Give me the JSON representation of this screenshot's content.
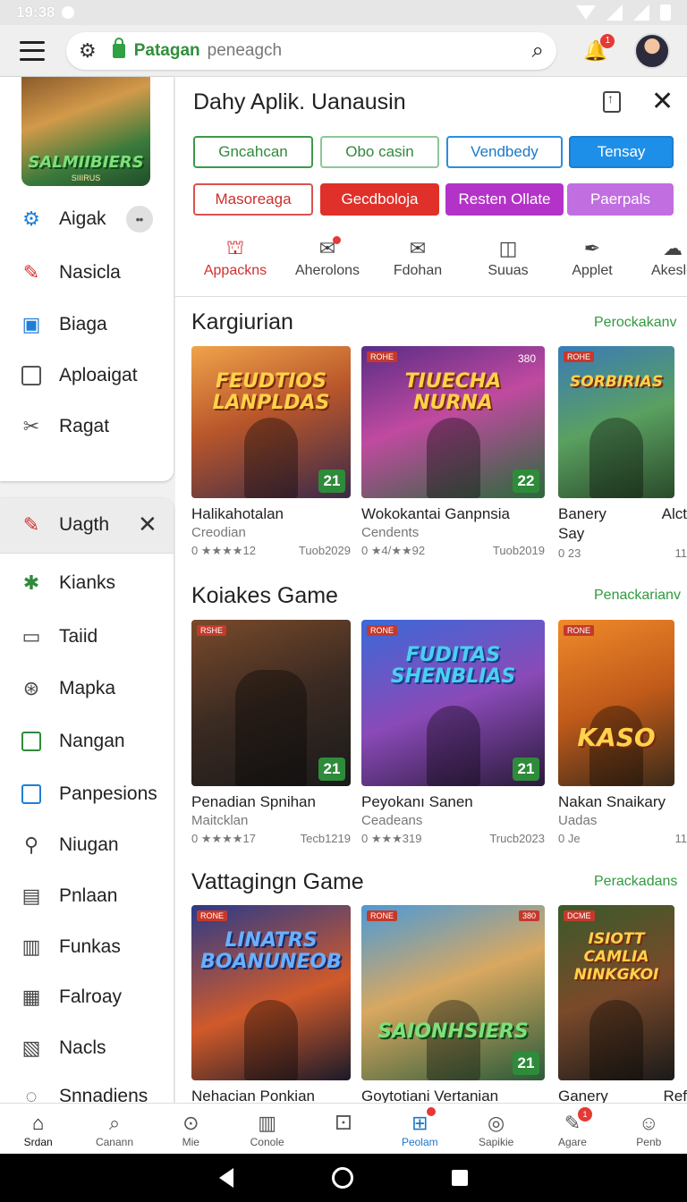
{
  "status": {
    "time": "19:38"
  },
  "appbar": {
    "brand": "Patagan",
    "query": "peneagch",
    "notif_count": "1"
  },
  "sidebar_top": {
    "items": [
      {
        "label": "Aigak",
        "icon": "gear-icon",
        "color": "#1e7fd8"
      },
      {
        "label": "Nasicla",
        "icon": "edit-box-icon",
        "color": "#d32f2f"
      },
      {
        "label": "Biaga",
        "icon": "bag-icon",
        "color": "#1e7fd8"
      },
      {
        "label": "Aploaigat",
        "icon": "square-icon",
        "color": "#555555"
      },
      {
        "label": "Ragat",
        "icon": "tools-icon",
        "color": "#555555"
      }
    ],
    "hero_logo": "SALMIIBIERS",
    "hero_sub": "SIIIRUS"
  },
  "sidebar_bottom": {
    "header": "Uagth",
    "items": [
      {
        "label": "Kianks",
        "icon": "puzzle-icon",
        "color": "#2e8b3a"
      },
      {
        "label": "Taiid",
        "icon": "clipboard-icon",
        "color": "#444444"
      },
      {
        "label": "Mapka",
        "icon": "map-pin-icon",
        "color": "#444444"
      },
      {
        "label": "Nangan",
        "icon": "green-square-icon",
        "color": "#2e8b3a"
      },
      {
        "label": "Panpesions",
        "icon": "blue-square-icon",
        "color": "#1e7fd8"
      },
      {
        "label": "Niugan",
        "icon": "link-icon",
        "color": "#444444"
      },
      {
        "label": "Pnlaan",
        "icon": "calendar-icon",
        "color": "#444444"
      },
      {
        "label": "Funkas",
        "icon": "list-box-icon",
        "color": "#444444"
      },
      {
        "label": "Falroay",
        "icon": "document-icon",
        "color": "#444444"
      },
      {
        "label": "Nacls",
        "icon": "folder-icon",
        "color": "#444444"
      },
      {
        "label": "Snnadiens",
        "icon": "chat-icon",
        "color": "#444444"
      }
    ]
  },
  "dialog": {
    "title": "Dahy Aplik. Uanausin",
    "chips_row1": [
      "Gncahcan",
      "Obo casin",
      "Vendbedy",
      "Tensay"
    ],
    "chips_row2": [
      "Masoreaga",
      "Gecdboloja",
      "Resten Ollate",
      "Paerpals"
    ],
    "tabs": [
      "Appackns",
      "Aherolons",
      "Fdohan",
      "Suuas",
      "Applet",
      "Akesle"
    ]
  },
  "sections": [
    {
      "title": "Kargiurian",
      "link": "Perockakanv",
      "cards": [
        {
          "logo": "FEUDTIOS LANPLDAS",
          "tag": "",
          "rank": "21",
          "title": "Halikahotalan",
          "sub": "Creodian",
          "rating": "0 ★★★★12",
          "date": "Tuob2029",
          "bg": "linear-gradient(160deg,#f0a34a 0%,#b8562b 45%,#3a2a4a 100%)"
        },
        {
          "logo": "TIUECHA NURNA",
          "tag": "ROHE",
          "badge": "380",
          "rank": "22",
          "title": "Wokokantai Ganpnsia",
          "sub": "Cendents",
          "rating": "0 ★4/★★92",
          "date": "Tuob2019",
          "bg": "linear-gradient(160deg,#5a2c86 0%,#c04aa0 45%,#2a6a3a 100%)"
        },
        {
          "logo": "SORBIRIAS",
          "tag": "ROHE",
          "rank": "",
          "title": "Banery",
          "title2": "Alct",
          "sub": "Say",
          "rating": "0 23",
          "date": "11",
          "bg": "linear-gradient(160deg,#3a7ab8 0%,#5aa060 50%,#2a4a2a 100%)"
        }
      ]
    },
    {
      "title": "Koiakes Game",
      "link": "Penackarianv",
      "cards": [
        {
          "logo": "",
          "tag": "RSHE",
          "rank": "21",
          "title": "Penadian Spnihan",
          "sub": "Maitcklan",
          "rating": "0 ★★★★17",
          "date": "Tecb1219",
          "bg": "linear-gradient(160deg,#7a4a2a 0%,#3a2a22 50%,#1a1a1a 100%)"
        },
        {
          "logo": "FUDITAS SHENBLIAS",
          "tag": "RONE",
          "rank": "21",
          "title": "Peyokanı Sanen",
          "sub": "Ceadeans",
          "rating": "0 ★★★319",
          "date": "Trucb2023",
          "bg": "linear-gradient(160deg,#3a6ad8 0%,#8a4ab8 50%,#2a1a3a 100%)"
        },
        {
          "logo": "KASO",
          "tag": "RONE",
          "rank": "",
          "title": "Nakan Snaikary",
          "sub": "Uadas",
          "rating": "0 Je",
          "date": "11",
          "bg": "linear-gradient(160deg,#f08a2a 0%,#c05a1a 50%,#3a2a1a 100%)"
        }
      ]
    },
    {
      "title": "Vattagingn Game",
      "link": "Perackadans",
      "cards": [
        {
          "logo": "LINATRS BOANUNEOB",
          "tag": "RONE",
          "rank": "",
          "title": "Nehacian Ponkian",
          "sub": "",
          "rating": "",
          "date": "",
          "bg": "linear-gradient(160deg,#2a3a8a 0%,#d05a2a 55%,#1a1a2a 100%)"
        },
        {
          "logo": "SAIONHSIERS",
          "tag": "RONE",
          "badge": "380",
          "rank": "21",
          "title": "Goytotiani Vertanian",
          "sub": "",
          "rating": "",
          "date": "",
          "bg": "linear-gradient(160deg,#4a9ad8 0%,#d8a860 45%,#2a5a3a 100%)"
        },
        {
          "logo": "ISIOTT CAMLIA NINKGKOI",
          "tag": "DCME",
          "rank": "",
          "title": "Ganery",
          "title2": "Ref",
          "sub": "",
          "rating": "",
          "date": "",
          "bg": "linear-gradient(160deg,#3a5a2a 0%,#7a4a2a 50%,#1a1a1a 100%)"
        }
      ]
    }
  ],
  "bottomnav": [
    {
      "label": "Srdan",
      "icon": "home-icon"
    },
    {
      "label": "Canann",
      "icon": "search-icon"
    },
    {
      "label": "Mie",
      "icon": "gamepad-icon"
    },
    {
      "label": "Conole",
      "icon": "box-icon"
    },
    {
      "label": "",
      "icon": "dice-icon"
    },
    {
      "label": "Peolam",
      "icon": "apps-grid-icon"
    },
    {
      "label": "Sapikie",
      "icon": "chat-bubble-icon"
    },
    {
      "label": "Agare",
      "icon": "edit-icon",
      "badge": "1"
    },
    {
      "label": "Penb",
      "icon": "person-icon"
    }
  ]
}
